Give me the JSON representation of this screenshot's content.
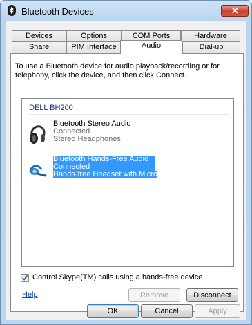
{
  "window": {
    "title": "Bluetooth Devices",
    "close_glyph": "✕"
  },
  "tabs": {
    "row_top": [
      "Devices",
      "Options",
      "COM Ports",
      "Hardware"
    ],
    "row_bottom": [
      "Share",
      "PIM Interface",
      "Audio",
      "Dial-up"
    ],
    "active": "Audio"
  },
  "description": "To use a Bluetooth device for audio playback/recording or for telephony, click the device, and then click Connect.",
  "device_group": {
    "name": "DELL BH200",
    "devices": [
      {
        "name": "Bluetooth Stereo Audio",
        "status": "Connected",
        "type": "Stereo Headphones",
        "icon": "headphones-icon",
        "selected": false
      },
      {
        "name": "Bluetooth Hands-Free Audio",
        "status": "Connected",
        "type": "Hands-free Headset with Micro...",
        "icon": "headset-icon",
        "selected": true
      }
    ]
  },
  "skype_option": {
    "label": "Control Skype(TM) calls using a hands-free device",
    "checked": true
  },
  "help_link": "Help",
  "buttons": {
    "remove": "Remove",
    "disconnect": "Disconnect",
    "ok": "OK",
    "cancel": "Cancel",
    "apply": "Apply"
  },
  "colors": {
    "selection": "#3399ff",
    "group_header": "#1e3287",
    "link": "#0044cc"
  }
}
